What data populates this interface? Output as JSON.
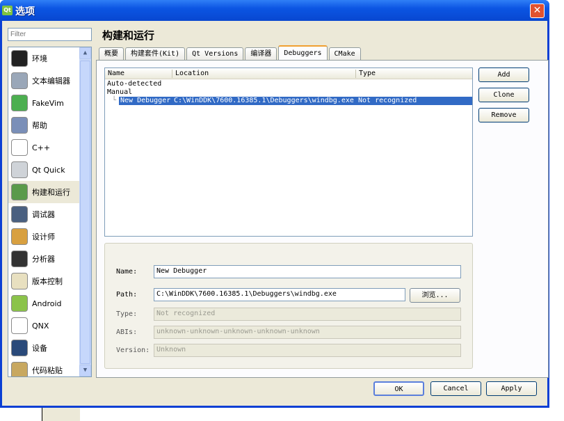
{
  "window": {
    "title": "选项",
    "close_label": "✕",
    "icon": "qt-logo-icon"
  },
  "filter": {
    "placeholder": "Filter"
  },
  "sidebar": {
    "items": [
      {
        "label": "环境",
        "icon": "monitor-icon",
        "color": "#222222"
      },
      {
        "label": "文本编辑器",
        "icon": "text-editor-icon",
        "color": "#9aa7b8"
      },
      {
        "label": "FakeVim",
        "icon": "fakevim-icon",
        "color": "#4caf50"
      },
      {
        "label": "帮助",
        "icon": "help-icon",
        "color": "#7a8fb8"
      },
      {
        "label": "C++",
        "icon": "cpp-braces-icon",
        "color": "#ffffff"
      },
      {
        "label": "Qt Quick",
        "icon": "paper-plane-icon",
        "color": "#cfd3d8"
      },
      {
        "label": "构建和运行",
        "icon": "build-run-icon",
        "color": "#5a9a4a",
        "selected": true
      },
      {
        "label": "调试器",
        "icon": "debugger-icon",
        "color": "#4a6080"
      },
      {
        "label": "设计师",
        "icon": "designer-icon",
        "color": "#d8a040"
      },
      {
        "label": "分析器",
        "icon": "analyzer-icon",
        "color": "#333333"
      },
      {
        "label": "版本控制",
        "icon": "version-control-icon",
        "color": "#e8e0c0"
      },
      {
        "label": "Android",
        "icon": "android-icon",
        "color": "#8bc34a"
      },
      {
        "label": "QNX",
        "icon": "qnx-icon",
        "color": "#ffffff"
      },
      {
        "label": "设备",
        "icon": "device-icon",
        "color": "#2a4a7a"
      },
      {
        "label": "代码粘贴",
        "icon": "code-paste-icon",
        "color": "#c8a860"
      }
    ]
  },
  "page_title": "构建和运行",
  "tabs": [
    {
      "label": "概要"
    },
    {
      "label": "构建套件(Kit)"
    },
    {
      "label": "Qt Versions"
    },
    {
      "label": "编译器"
    },
    {
      "label": "Debuggers",
      "active": true
    },
    {
      "label": "CMake"
    }
  ],
  "tree": {
    "columns": [
      "Name",
      "Location",
      "Type"
    ],
    "groups": [
      "Auto-detected",
      "Manual"
    ],
    "selected_row": {
      "name": "New Debugger",
      "location": "C:\\WinDDK\\7600.16385.1\\Debuggers\\windbg.exe",
      "type": "Not recognized"
    }
  },
  "side_buttons": {
    "add": "Add",
    "clone": "Clone",
    "remove": "Remove"
  },
  "details": {
    "name_label": "Name:",
    "name_value": "New Debugger",
    "path_label": "Path:",
    "path_value": "C:\\WinDDK\\7600.16385.1\\Debuggers\\windbg.exe",
    "browse": "浏览...",
    "type_label": "Type:",
    "type_value": "Not recognized",
    "abis_label": "ABIs:",
    "abis_value": "unknown-unknown-unknown-unknown-unknown",
    "version_label": "Version:",
    "version_value": "Unknown"
  },
  "footer": {
    "ok": "OK",
    "cancel": "Cancel",
    "apply": "Apply"
  },
  "colors": {
    "selection": "#316ac5",
    "titlebar": "#0b55e3",
    "active_tab_accent": "#f0a030"
  }
}
